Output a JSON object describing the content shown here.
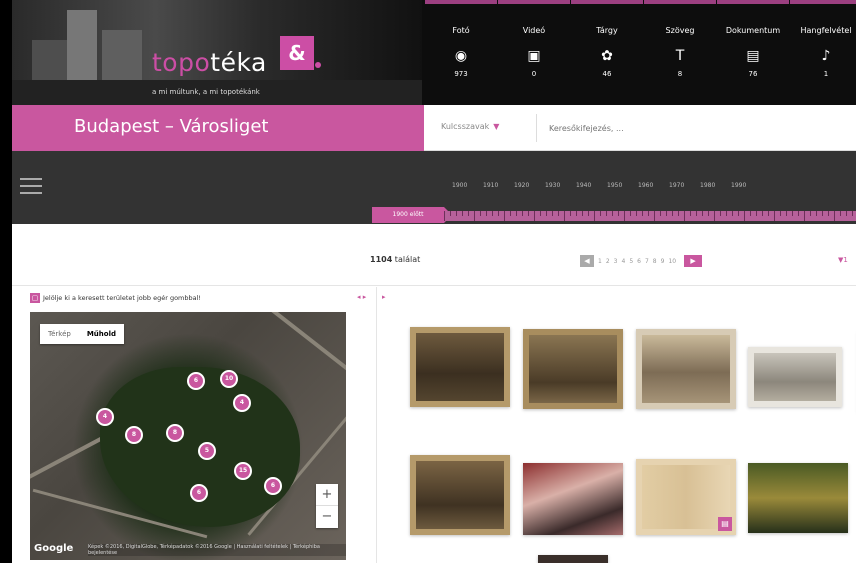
{
  "header": {
    "logo_topo": "topo",
    "logo_teka": "téka",
    "logo_badge": "&",
    "tagline": "a mi múltunk, a mi topotékánk"
  },
  "media_tabs": [
    {
      "label": "Fotó",
      "icon": "camera-icon",
      "glyph": "◉",
      "count": "973"
    },
    {
      "label": "Videó",
      "icon": "film-icon",
      "glyph": "▣",
      "count": "0"
    },
    {
      "label": "Tárgy",
      "icon": "object-icon",
      "glyph": "✿",
      "count": "46"
    },
    {
      "label": "Szöveg",
      "icon": "text-icon",
      "glyph": "T",
      "count": "8"
    },
    {
      "label": "Dokumentum",
      "icon": "document-icon",
      "glyph": "▤",
      "count": "76"
    },
    {
      "label": "Hangfelvétel",
      "icon": "audio-icon",
      "glyph": "♪",
      "count": "1"
    }
  ],
  "title": "Budapest – Városliget",
  "search": {
    "keywords_label": "Kulcsszavak",
    "keywords_arrow": "▼",
    "placeholder": "Keresőkifejezés, ..."
  },
  "timeline": {
    "years": [
      "1900",
      "1910",
      "1920",
      "1930",
      "1940",
      "1950",
      "1960",
      "1970",
      "1980",
      "1990"
    ],
    "before_label": "1900 előtt"
  },
  "results": {
    "count": "1104",
    "count_suffix": " találat",
    "pages": [
      "1",
      "2",
      "3",
      "4",
      "5",
      "6",
      "7",
      "8",
      "9",
      "10"
    ],
    "sort_flag": "▼1"
  },
  "map": {
    "hint": "Jelölje ki a keresett területet jobb egér gombbal!",
    "type_options": [
      "Térkép",
      "Műhold"
    ],
    "active_type": "Műhold",
    "markers": [
      "6",
      "10",
      "4",
      "4",
      "8",
      "8",
      "5",
      "15",
      "6",
      "6"
    ],
    "zoom_in": "+",
    "zoom_out": "−",
    "google": "Google",
    "attribution": "Képek ©2016, DigitalGlobe, Térképadatok ©2016 Google | Használati feltételek | Térképhiba bejelentése"
  },
  "colors": {
    "accent": "#c9579f",
    "header_bg": "#0d0d0d",
    "timeline_bg": "#333333"
  }
}
